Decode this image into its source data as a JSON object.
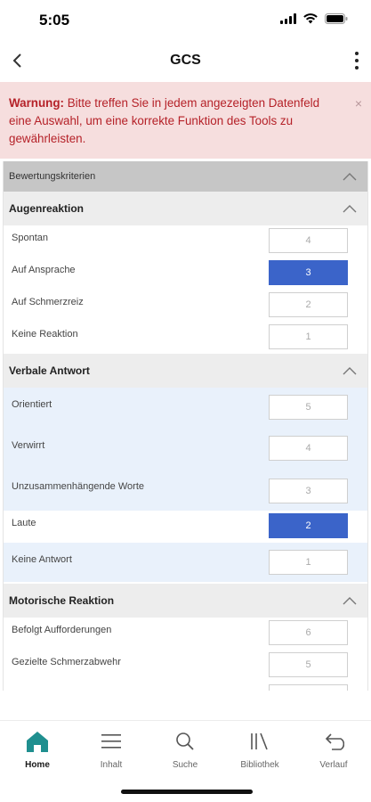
{
  "status_bar": {
    "time": "5:05"
  },
  "nav": {
    "title": "GCS"
  },
  "warning": {
    "strong": "Warnung:",
    "text": " Bitte treffen Sie in jedem angezeigten Datenfeld eine Auswahl, um eine korrekte Funktion des Tools zu gewährleisten.",
    "close": "×"
  },
  "criteria_header": "Bewertungskriterien",
  "sections": {
    "augen": {
      "title": "Augenreaktion",
      "rows": [
        {
          "label": "Spontan",
          "score": "4",
          "selected": false
        },
        {
          "label": "Auf Ansprache",
          "score": "3",
          "selected": true
        },
        {
          "label": "Auf Schmerzreiz",
          "score": "2",
          "selected": false
        },
        {
          "label": "Keine Reaktion",
          "score": "1",
          "selected": false
        }
      ]
    },
    "verbal": {
      "title": "Verbale Antwort",
      "rows": [
        {
          "label": "Orientiert",
          "score": "5",
          "selected": false
        },
        {
          "label": "Verwirrt",
          "score": "4",
          "selected": false
        },
        {
          "label": "Unzusammenhängende Worte",
          "score": "3",
          "selected": false
        },
        {
          "label": "Laute",
          "score": "2",
          "selected": true
        },
        {
          "label": "Keine Antwort",
          "score": "1",
          "selected": false
        }
      ]
    },
    "motor": {
      "title": "Motorische Reaktion",
      "rows": [
        {
          "label": "Befolgt Aufforderungen",
          "score": "6",
          "selected": false
        },
        {
          "label": "Gezielte Schmerzabwehr",
          "score": "5",
          "selected": false
        }
      ]
    }
  },
  "tabs": [
    {
      "label": "Home",
      "icon": "home-icon",
      "active": true
    },
    {
      "label": "Inhalt",
      "icon": "menu-icon",
      "active": false
    },
    {
      "label": "Suche",
      "icon": "search-icon",
      "active": false
    },
    {
      "label": "Bibliothek",
      "icon": "library-icon",
      "active": false
    },
    {
      "label": "Verlauf",
      "icon": "history-icon",
      "active": false
    }
  ],
  "colors": {
    "accent": "#3b64c9",
    "warning_bg": "#f6dede",
    "warning_text": "#b52128",
    "home_tab": "#1f8f8f"
  }
}
